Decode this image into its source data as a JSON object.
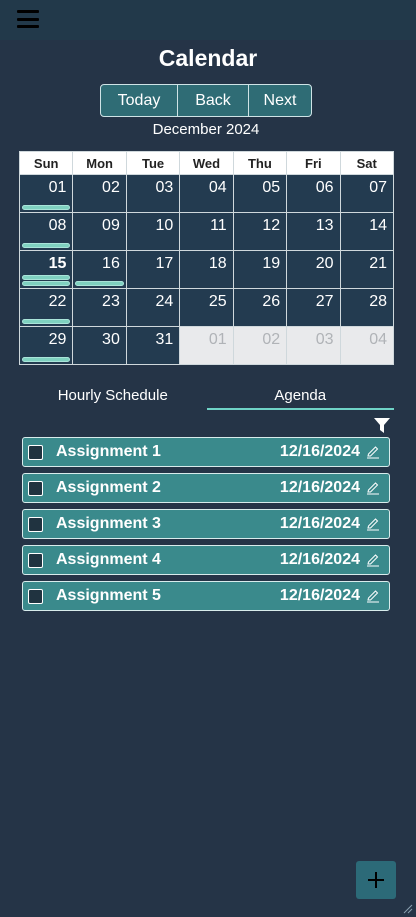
{
  "header": {
    "menu_icon": "hamburger-icon"
  },
  "page_title": "Calendar",
  "nav": {
    "today": "Today",
    "back": "Back",
    "next": "Next"
  },
  "month_label": "December 2024",
  "weekdays": [
    "Sun",
    "Mon",
    "Tue",
    "Wed",
    "Thu",
    "Fri",
    "Sat"
  ],
  "weeks": [
    [
      {
        "d": "01",
        "events": 1
      },
      {
        "d": "02"
      },
      {
        "d": "03"
      },
      {
        "d": "04"
      },
      {
        "d": "05"
      },
      {
        "d": "06"
      },
      {
        "d": "07"
      }
    ],
    [
      {
        "d": "08",
        "events": 1
      },
      {
        "d": "09"
      },
      {
        "d": "10"
      },
      {
        "d": "11"
      },
      {
        "d": "12"
      },
      {
        "d": "13"
      },
      {
        "d": "14"
      }
    ],
    [
      {
        "d": "15",
        "events": 2,
        "today": true
      },
      {
        "d": "16",
        "events": 1
      },
      {
        "d": "17"
      },
      {
        "d": "18"
      },
      {
        "d": "19"
      },
      {
        "d": "20"
      },
      {
        "d": "21"
      }
    ],
    [
      {
        "d": "22",
        "events": 1
      },
      {
        "d": "23"
      },
      {
        "d": "24"
      },
      {
        "d": "25"
      },
      {
        "d": "26"
      },
      {
        "d": "27"
      },
      {
        "d": "28"
      }
    ],
    [
      {
        "d": "29",
        "events": 1
      },
      {
        "d": "30"
      },
      {
        "d": "31"
      },
      {
        "d": "01",
        "other": true
      },
      {
        "d": "02",
        "other": true
      },
      {
        "d": "03",
        "other": true
      },
      {
        "d": "04",
        "other": true
      }
    ]
  ],
  "tabs": {
    "hourly": "Hourly Schedule",
    "agenda": "Agenda",
    "active": "agenda"
  },
  "filter_icon": "filter-icon",
  "assignments": [
    {
      "name": "Assignment 1",
      "date": "12/16/2024"
    },
    {
      "name": "Assignment 2",
      "date": "12/16/2024"
    },
    {
      "name": "Assignment 3",
      "date": "12/16/2024"
    },
    {
      "name": "Assignment 4",
      "date": "12/16/2024"
    },
    {
      "name": "Assignment 5",
      "date": "12/16/2024"
    }
  ],
  "fab_icon": "plus-icon",
  "colors": {
    "background": "#253447",
    "accent": "#3a8a8c",
    "event_bar": "#7fd1c0",
    "tab_underline": "#6fd3c6"
  }
}
